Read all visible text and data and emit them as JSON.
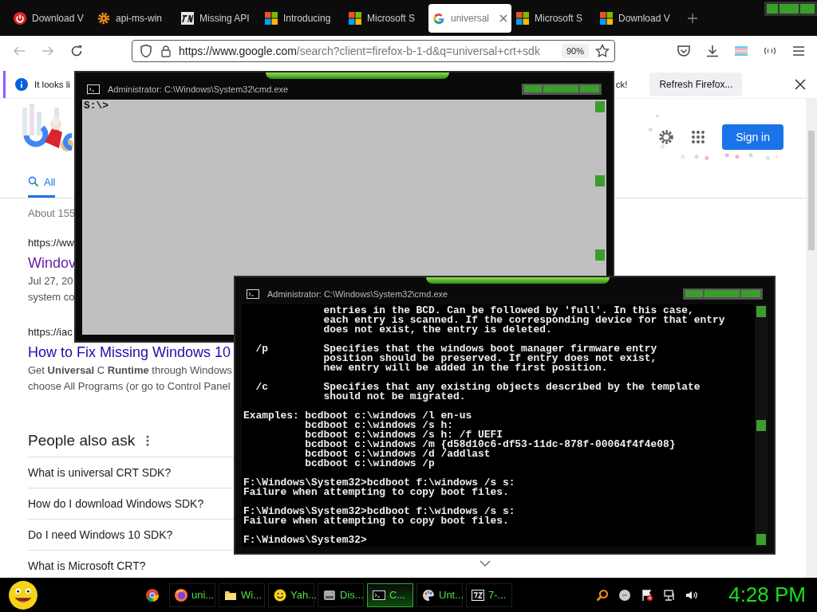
{
  "browser": {
    "tabs": [
      {
        "label": "Download V",
        "kind": "power",
        "selected": false
      },
      {
        "label": "api-ms-win",
        "kind": "gear",
        "selected": false
      },
      {
        "label": "Missing API",
        "kind": "tn",
        "selected": false
      },
      {
        "label": "Introducing",
        "kind": "windows",
        "selected": false
      },
      {
        "label": "Microsoft S",
        "kind": "windows",
        "selected": false
      },
      {
        "label": "universal",
        "kind": "google",
        "selected": true
      },
      {
        "label": "Microsoft S",
        "kind": "windows",
        "selected": false
      },
      {
        "label": "Download V",
        "kind": "windows",
        "selected": false
      }
    ],
    "address": {
      "url_host": "https://www.google.com",
      "url_rest": "/search?client=firefox-b-1-d&q=universal+crt+sdk",
      "zoom": "90%"
    },
    "notification": {
      "text_start": "It looks li",
      "text_end": "ck!",
      "button": "Refresh Firefox..."
    },
    "search_page": {
      "tabs": [
        {
          "label": "All",
          "selected": true
        }
      ],
      "sign_in": "Sign in",
      "result_count": "About 155",
      "results": [
        {
          "url": "https://ww",
          "title": "Windov",
          "visited": true,
          "snippet": [
            "Jul 27, 20",
            "system co"
          ]
        },
        {
          "url": "https://iac",
          "title": "How to Fix Missing Windows 10",
          "visited": false,
          "snippet": [
            "Get **Universal** C **Runtime** through Windows",
            "choose All Programs (or go to Control Panel"
          ]
        }
      ],
      "people_also_ask": {
        "heading": "People also ask",
        "questions": [
          "What is universal CRT SDK?",
          "How do I download Windows SDK?",
          "Do I need Windows 10 SDK?",
          "What is Microsoft CRT?"
        ]
      }
    }
  },
  "windows": [
    {
      "title": "Administrator: C:\\Windows\\System32\\cmd.exe",
      "kind": "light",
      "blocks": [
        [
          "S:\\>"
        ]
      ]
    },
    {
      "title": "Administrator: C:\\Windows\\System32\\cmd.exe",
      "kind": "dark",
      "blocks": [
        [
          "             entries in the BCD. Can be followed by 'full'. In this case,",
          "             each entry is scanned. If the corresponding device for that entry",
          "             does not exist, the entry is deleted."
        ],
        [
          "  /p         Specifies that the windows boot manager firmware entry",
          "             position should be preserved. If entry does not exist,",
          "             new entry will be added in the first position."
        ],
        [
          "  /c         Specifies that any existing objects described by the template",
          "             should not be migrated."
        ],
        [
          "Examples: bcdboot c:\\windows /l en-us",
          "          bcdboot c:\\windows /s h:",
          "          bcdboot c:\\windows /s h: /f UEFI",
          "          bcdboot c:\\windows /m {d58d10c6-df53-11dc-878f-00064f4f4e08}",
          "          bcdboot c:\\windows /d /addlast",
          "          bcdboot c:\\windows /p"
        ],
        [
          "F:\\Windows\\System32>bcdboot f:\\windows /s s:",
          "Failure when attempting to copy boot files."
        ],
        [
          "F:\\Windows\\System32>bcdboot f:\\windows /s s:",
          "Failure when attempting to copy boot files."
        ],
        [
          "F:\\Windows\\System32>"
        ]
      ]
    }
  ],
  "taskbar": {
    "items": [
      {
        "kind": "chrome",
        "selected": false
      },
      {
        "label": "uni...",
        "kind": "firefox",
        "selected": false
      },
      {
        "label": "Wi...",
        "kind": "folder",
        "selected": false
      },
      {
        "label": "Yah...",
        "kind": "smiley",
        "selected": false
      },
      {
        "label": "Dis...",
        "kind": "disk",
        "selected": false
      },
      {
        "label": "C...",
        "kind": "console",
        "selected": true
      },
      {
        "label": "Unt...",
        "kind": "paint",
        "selected": false
      },
      {
        "label": "7-...",
        "kind": "archive",
        "selected": false
      }
    ],
    "clock": "4:28 PM"
  }
}
